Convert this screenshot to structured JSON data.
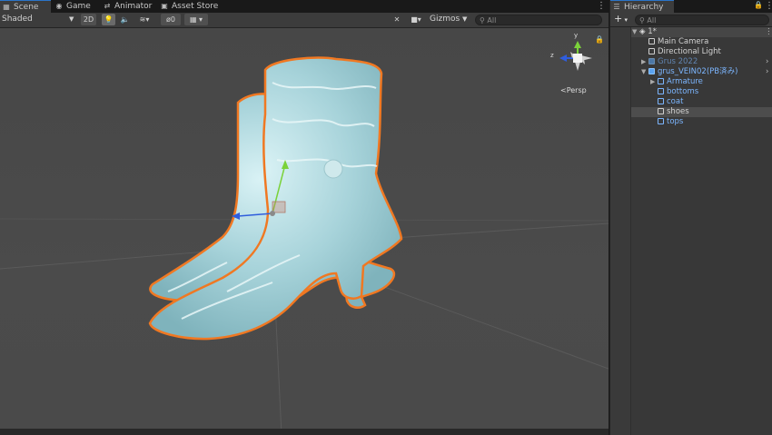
{
  "tabs": [
    {
      "label": "Scene",
      "icon": "grid-icon"
    },
    {
      "label": "Game",
      "icon": "gamepad-icon"
    },
    {
      "label": "Animator",
      "icon": "animator-icon"
    },
    {
      "label": "Asset Store",
      "icon": "store-icon"
    }
  ],
  "toolbar": {
    "shading_mode": "Shaded",
    "toggle_2d": "2D",
    "fx_count": "0",
    "gizmos_label": "Gizmos",
    "search_placeholder": "All"
  },
  "scene": {
    "projection_label": "Persp",
    "gizmo_axes": {
      "y": "y",
      "z": "z",
      "x": "x"
    },
    "colors": {
      "selection_outline": "#f07822",
      "model": "#a9d8de",
      "grid": "#5c5c5c"
    }
  },
  "hierarchy": {
    "title": "Hierarchy",
    "search_placeholder": "All",
    "root": "1*",
    "items": [
      {
        "label": "Main Camera",
        "depth": 1,
        "prefab": false,
        "expander": ""
      },
      {
        "label": "Directional Light",
        "depth": 1,
        "prefab": false,
        "expander": ""
      },
      {
        "label": "Grus 2022",
        "depth": 1,
        "prefab": true,
        "expander": "▶",
        "dim": true
      },
      {
        "label": "grus_VEIN02(PB済み)",
        "depth": 1,
        "prefab": true,
        "expander": "▼"
      },
      {
        "label": "Armature",
        "depth": 2,
        "prefab": true,
        "expander": "▶"
      },
      {
        "label": "bottoms",
        "depth": 2,
        "prefab": true,
        "expander": ""
      },
      {
        "label": "coat",
        "depth": 2,
        "prefab": true,
        "expander": ""
      },
      {
        "label": "shoes",
        "depth": 2,
        "prefab": true,
        "expander": "",
        "selected": true
      },
      {
        "label": "tops",
        "depth": 2,
        "prefab": true,
        "expander": ""
      }
    ]
  }
}
